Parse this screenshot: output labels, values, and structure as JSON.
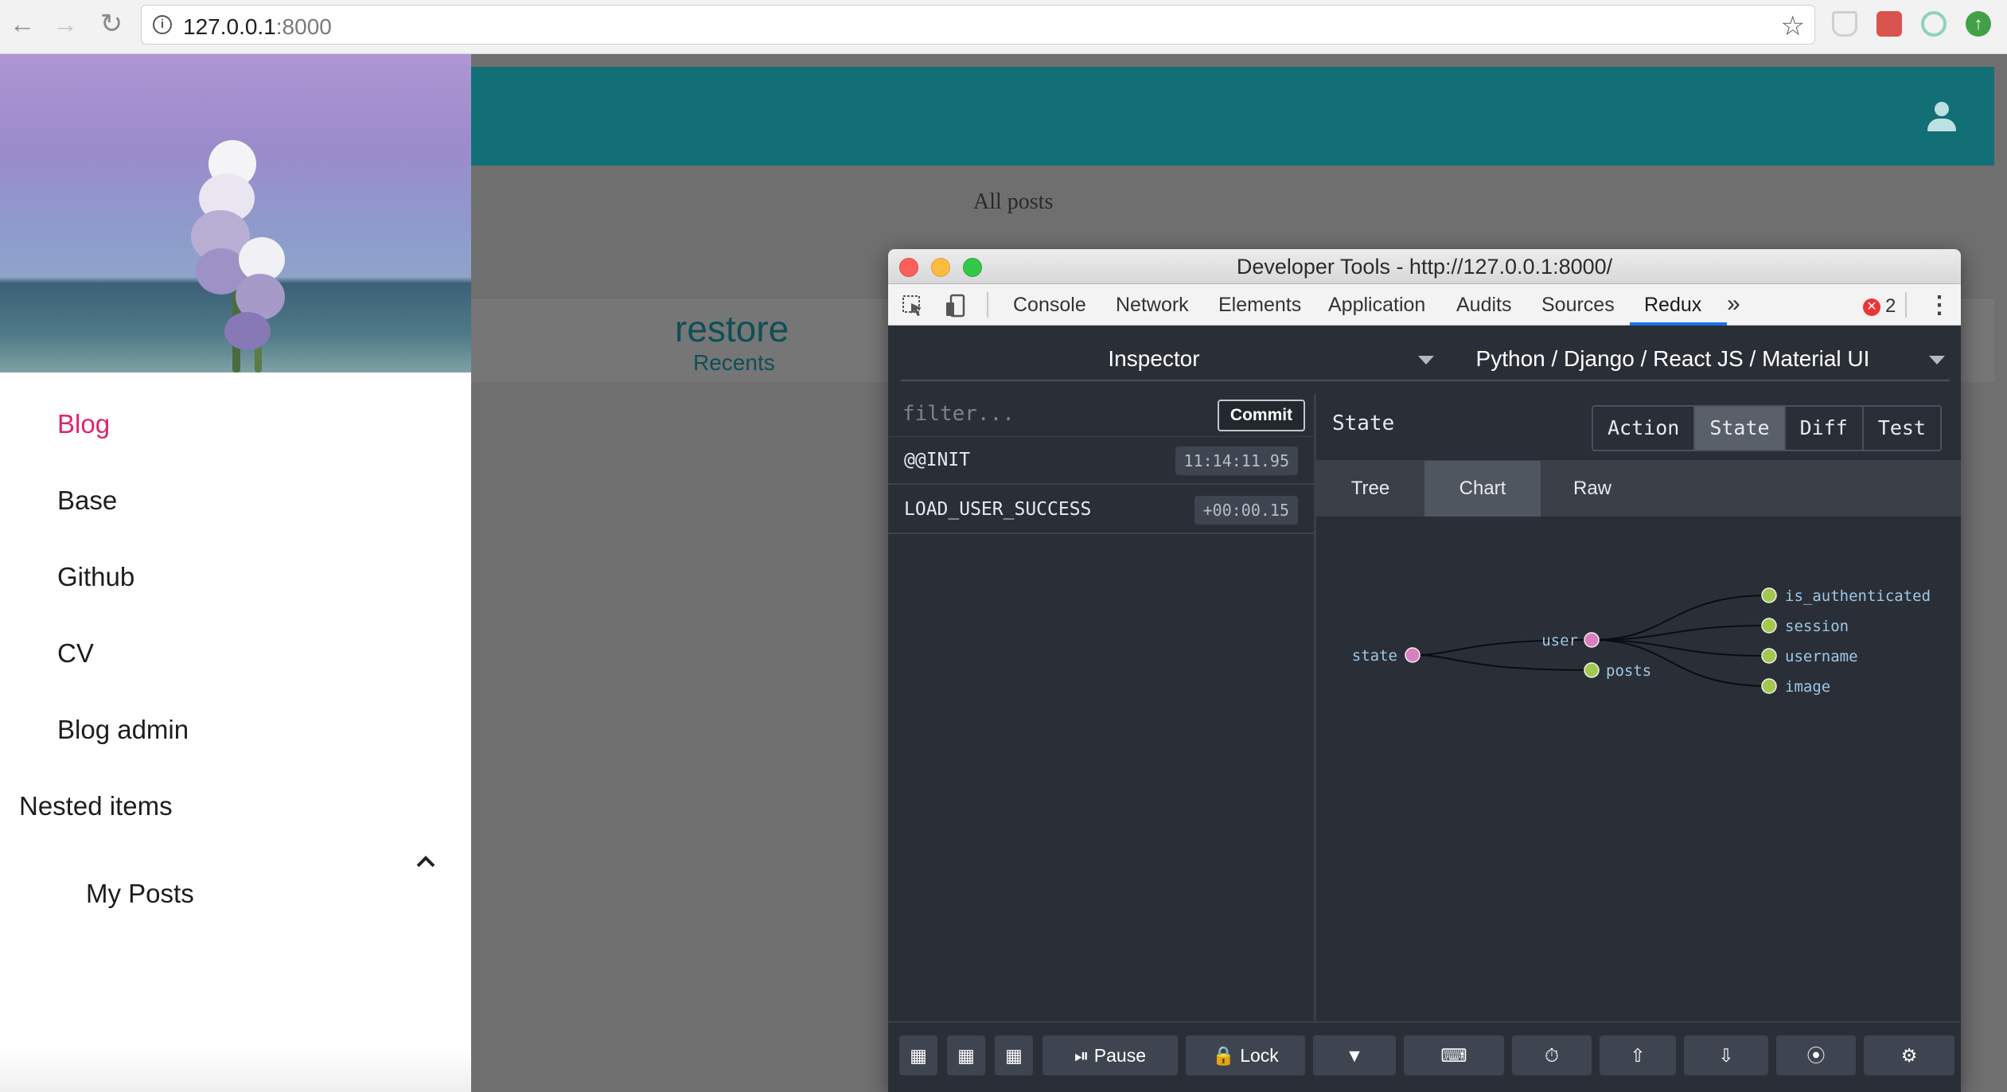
{
  "browser": {
    "url_host": "127.0.0.1",
    "url_port": ":8000"
  },
  "app": {
    "page_heading": "All posts",
    "site_name": "restore",
    "site_subtitle": "Recents"
  },
  "drawer": {
    "items": [
      {
        "label": "Blog",
        "active": true
      },
      {
        "label": "Base"
      },
      {
        "label": "Github"
      },
      {
        "label": "CV"
      },
      {
        "label": "Blog admin"
      }
    ],
    "nested_label": "Nested items",
    "nested_child": "My Posts"
  },
  "devtools": {
    "title": "Developer Tools - http://127.0.0.1:8000/",
    "tabs": [
      "Console",
      "Network",
      "Elements",
      "Application",
      "Audits",
      "Sources",
      "Redux"
    ],
    "active_tab": "Redux",
    "more_tabs": "»",
    "error_count": "2",
    "redux": {
      "monitor": "Inspector",
      "instance": "Python / Django / React JS / Material UI",
      "filter_placeholder": "filter...",
      "commit_label": "Commit",
      "actions": [
        {
          "name": "@@INIT",
          "time": "11:14:11.95"
        },
        {
          "name": "LOAD_USER_SUCCESS",
          "time": "+00:00.15"
        }
      ],
      "pane_title": "State",
      "modes": [
        "Action",
        "State",
        "Diff",
        "Test"
      ],
      "active_mode": "State",
      "sub_tabs": [
        "Tree",
        "Chart",
        "Raw"
      ],
      "active_sub_tab": "Chart",
      "tree_nodes": {
        "root": "state",
        "user": "user",
        "posts": "posts",
        "leaves": [
          "is_authenticated",
          "session",
          "username",
          "image"
        ]
      },
      "toolbar": {
        "pause": "Pause",
        "lock": "Lock"
      }
    }
  },
  "colors": {
    "appbar": "#126f76",
    "accent_pink": "#e0246c",
    "node_object": "#d77fc0",
    "node_leaf": "#a1c94f",
    "node_text": "#9fc7e6"
  }
}
